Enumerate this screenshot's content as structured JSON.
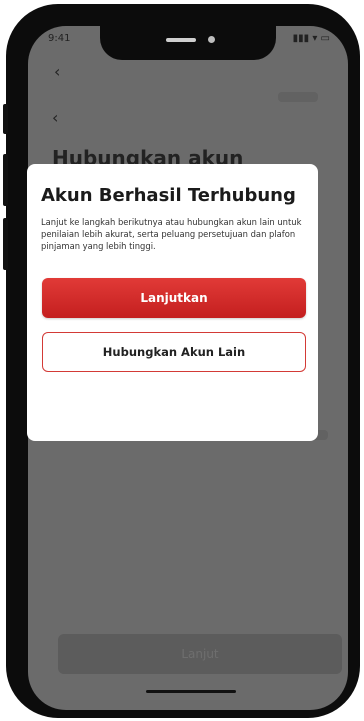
{
  "status_bar": {
    "time": "9:41",
    "indicators": "▮▮▮ ▾ ▭"
  },
  "nav": {
    "back_icon": "chevron-left-icon"
  },
  "page": {
    "title": "Hubungkan akun"
  },
  "footer": {
    "next_label": "Lanjut"
  },
  "dialog": {
    "title": "Akun Berhasil Terhubung",
    "body": "Lanjut ke langkah berikutnya atau hubungkan akun lain untuk penilaian lebih akurat, serta peluang persetujuan dan plafon pinjaman yang lebih tinggi.",
    "primary_label": "Lanjutkan",
    "secondary_label": "Hubungkan Akun Lain"
  },
  "colors": {
    "accent": "#d12b2b",
    "overlay": "#6b6b6b"
  }
}
